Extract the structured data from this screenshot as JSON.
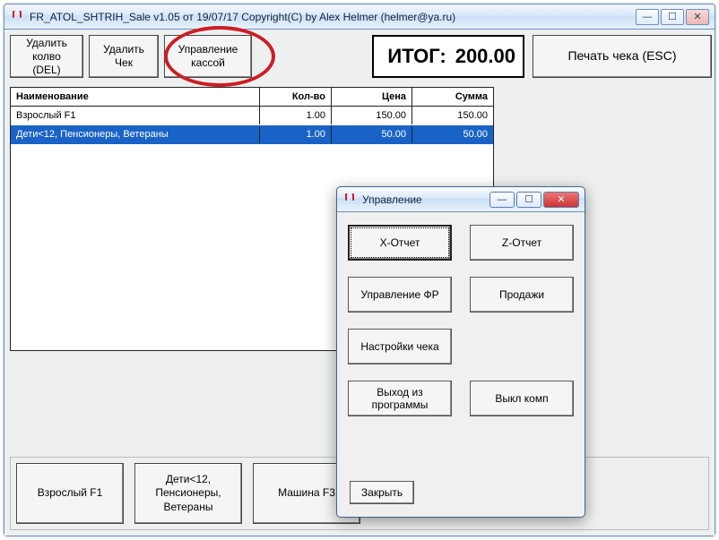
{
  "window": {
    "title": "FR_ATOL_SHTRIH_Sale v1.05 от 19/07/17 Copyright(C) by Alex Helmer  (helmer@ya.ru)"
  },
  "toolbar": {
    "delete_qty": "Удалить\nколво\n(DEL)",
    "delete_check": "Удалить\nЧек",
    "manage_cash": "Управление\nкассой",
    "print_check": "Печать чека (ESC)"
  },
  "total": {
    "label": "ИТОГ:",
    "value": "200.00"
  },
  "table": {
    "headers": {
      "name": "Наименование",
      "qty": "Кол-во",
      "price": "Цена",
      "sum": "Сумма"
    },
    "rows": [
      {
        "name": "Взрослый F1",
        "qty": "1.00",
        "price": "150.00",
        "sum": "150.00",
        "selected": false
      },
      {
        "name": "Дети<12, Пенсионеры, Ветераны",
        "qty": "1.00",
        "price": "50.00",
        "sum": "50.00",
        "selected": true
      }
    ]
  },
  "bottom": {
    "b1": "Взрослый F1",
    "b2": "Дети<12,\nПенсионеры,\nВетераны",
    "b3": "Машина F3"
  },
  "dialog": {
    "title": "Управление",
    "x_report": "X-Отчет",
    "z_report": "Z-Отчет",
    "manage_fr": "Управление ФР",
    "sales": "Продажи",
    "check_settings": "Настройки чека",
    "exit_program": "Выход из\nпрограммы",
    "shutdown": "Выкл комп",
    "close": "Закрыть"
  }
}
